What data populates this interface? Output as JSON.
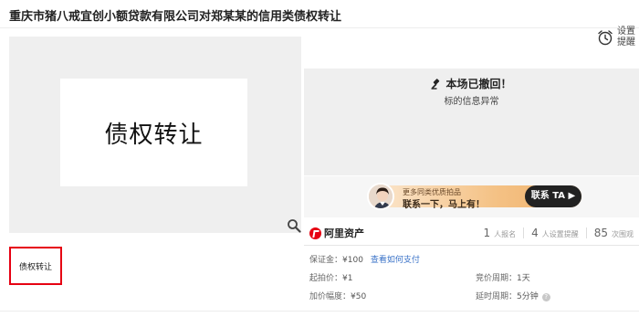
{
  "page": {
    "title": "重庆市猪八戒宜创小额贷款有限公司对郑某某的信用类债权转让"
  },
  "remind": {
    "line1": "设置",
    "line2": "提醒",
    "icon": "alarm-clock-icon"
  },
  "preview": {
    "main_text": "债权转让",
    "thumb_text": "债权转让",
    "zoom_icon": "magnifier-icon"
  },
  "status": {
    "headline": "本场已撤回！",
    "subtext": "标的信息异常",
    "icon": "gavel-icon"
  },
  "promo": {
    "line1": "更多同类优质拍品",
    "line2": "联系一下，马上有！",
    "button": "联系 TA ▶"
  },
  "brand": {
    "name": "阿里资产",
    "color": "#e60012"
  },
  "stats": [
    {
      "num": "1",
      "label": "人报名"
    },
    {
      "num": "4",
      "label": "人设置提醒"
    },
    {
      "num": "85",
      "label": "次围观"
    }
  ],
  "info": {
    "deposit_label": "保证金：",
    "deposit_value": "¥100",
    "deposit_link": "查看如何支付",
    "start_label": "起拍价：",
    "start_value": "¥1",
    "period_label": "竞价周期：",
    "period_value": "1天",
    "increment_label": "加价幅度：",
    "increment_value": "¥50",
    "delay_label": "延时周期：",
    "delay_value": "5分钟"
  },
  "colors": {
    "accent_red": "#e60012",
    "link_blue": "#3b73c8",
    "promo_gold": "#f4c184"
  }
}
